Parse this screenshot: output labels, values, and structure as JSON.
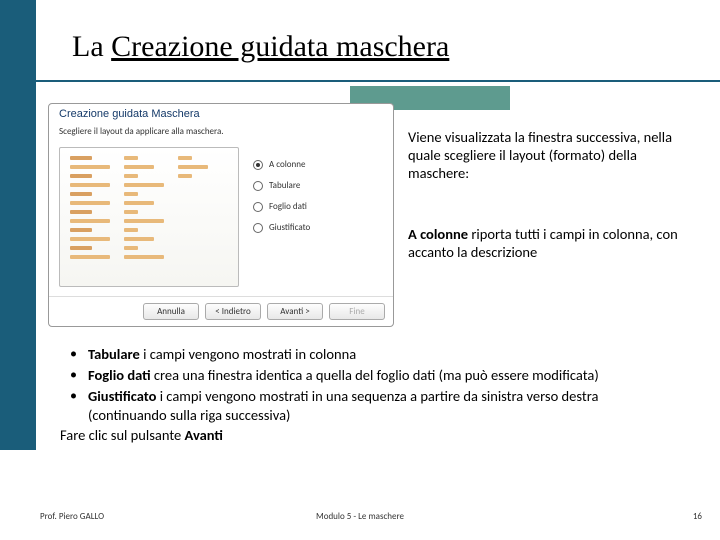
{
  "title_plain": "La ",
  "title_underline": "Creazione guidata maschera",
  "dialog": {
    "title": "Creazione guidata Maschera",
    "subtitle": "Scegliere il layout da applicare alla maschera.",
    "options": [
      {
        "label": "A colonne",
        "selected": true
      },
      {
        "label": "Tabulare",
        "selected": false
      },
      {
        "label": "Foglio dati",
        "selected": false
      },
      {
        "label": "Giustificato",
        "selected": false
      }
    ],
    "buttons": {
      "cancel": "Annulla",
      "back": "< Indietro",
      "next": "Avanti >",
      "finish": "Fine"
    }
  },
  "right1": "Viene visualizzata la finestra successiva, nella quale scegliere il layout (formato)\ndella maschere:",
  "right2_bold": "A colonne",
  "right2_rest": " riporta tutti i campi in colonna,\ncon accanto la descrizione",
  "bullet1_bold": "Tabulare",
  "bullet1_rest": " i campi vengono mostrati in colonna",
  "bullet2_bold": "Foglio dati",
  "bullet2_rest": " crea una finestra identica a quella del foglio dati (ma può essere modificata)",
  "bullet3_bold": "Giustificato",
  "bullet3_rest": " i campi vengono mostrati in una sequenza a partire da sinistra verso destra (continuando sulla riga successiva)",
  "closing_pre": "Fare clic sul pulsante ",
  "closing_bold": "Avanti",
  "footer": {
    "left": "Prof. Piero GALLO",
    "center": "Modulo 5  -   Le maschere",
    "right": "16"
  }
}
